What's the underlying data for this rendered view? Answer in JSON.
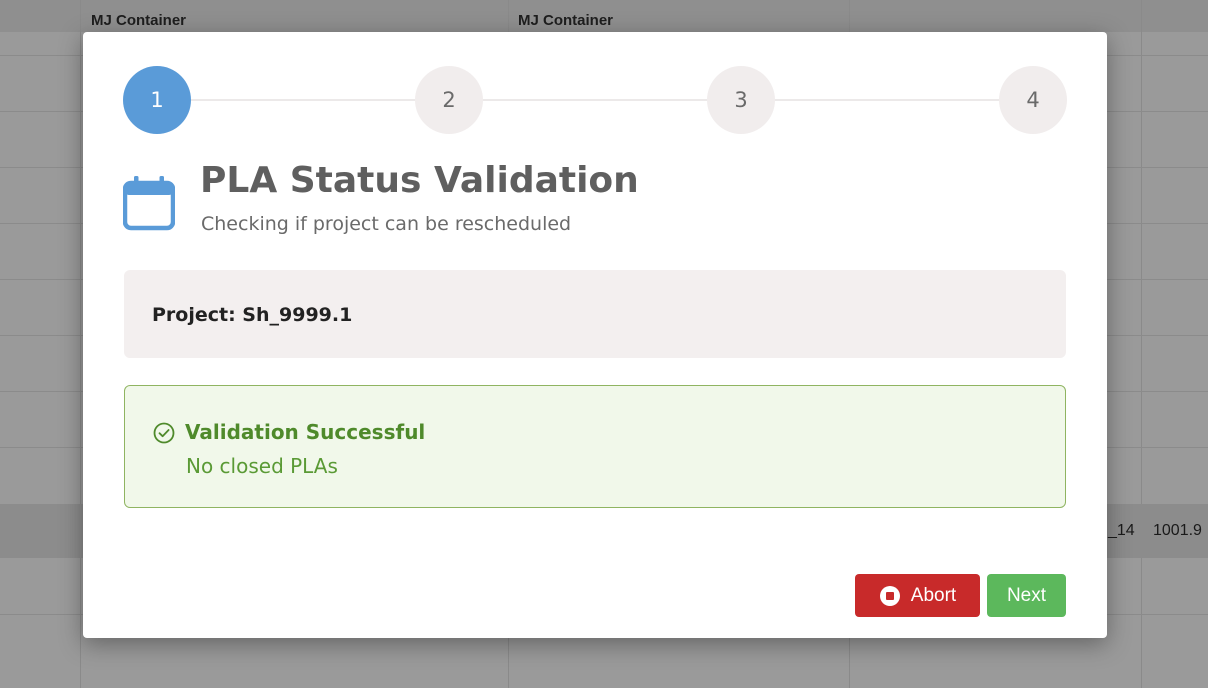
{
  "background": {
    "column_headers": [
      "MJ Container",
      "MJ Container"
    ],
    "row_cells": [
      "_14",
      "1001.9"
    ]
  },
  "stepper": {
    "steps": [
      "1",
      "2",
      "3",
      "4"
    ],
    "active_step": 1
  },
  "heading": {
    "icon": "calendar-icon",
    "title": "PLA Status Validation",
    "subtitle": "Checking if project can be rescheduled"
  },
  "project": {
    "label": "Project: Sh_9999.1"
  },
  "validation": {
    "icon": "check-circle-icon",
    "title": "Validation Successful",
    "message": "No closed PLAs"
  },
  "buttons": {
    "abort_label": "Abort",
    "abort_icon": "stop-circle-icon",
    "next_label": "Next"
  },
  "colors": {
    "accent": "#5a9bd8",
    "success": "#4f8a2b",
    "danger": "#c82a2a",
    "next": "#5cb85c"
  }
}
